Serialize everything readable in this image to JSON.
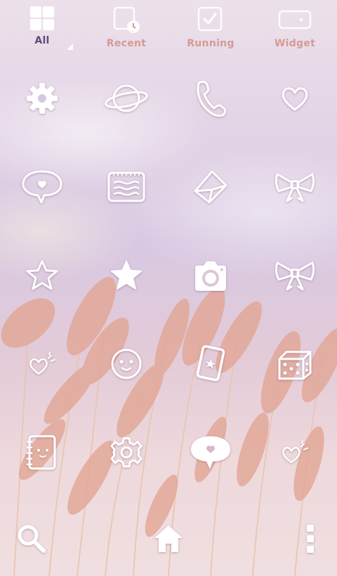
{
  "tabs": [
    {
      "label": "All",
      "icon": "grid-icon",
      "active": true
    },
    {
      "label": "Recent",
      "icon": "recent-clock-icon",
      "active": false
    },
    {
      "label": "Running",
      "icon": "checkbox-icon",
      "active": false
    },
    {
      "label": "Widget",
      "icon": "widget-icon",
      "active": false
    }
  ],
  "apps": [
    {
      "icon": "gear-icon"
    },
    {
      "icon": "planet-icon"
    },
    {
      "icon": "phone-icon"
    },
    {
      "icon": "heart-icon"
    },
    {
      "icon": "heart-speech-bubble-icon"
    },
    {
      "icon": "notepad-icon"
    },
    {
      "icon": "envelope-icon"
    },
    {
      "icon": "ribbon-bow-icon"
    },
    {
      "icon": "star-outline-icon"
    },
    {
      "icon": "star-filled-icon"
    },
    {
      "icon": "camera-icon"
    },
    {
      "icon": "ribbon-bow-icon"
    },
    {
      "icon": "small-heart-icon"
    },
    {
      "icon": "smiley-face-icon"
    },
    {
      "icon": "playing-card-icon"
    },
    {
      "icon": "dice-icon"
    },
    {
      "icon": "notebook-face-icon"
    },
    {
      "icon": "gear-outline-icon"
    },
    {
      "icon": "heart-speech-filled-icon"
    },
    {
      "icon": "small-heart-icon"
    }
  ],
  "dock": [
    {
      "icon": "search-icon"
    },
    {
      "icon": "home-icon"
    },
    {
      "icon": "more-vertical-icon"
    }
  ],
  "colors": {
    "tab_active": "#5b4d78",
    "tab_inactive": "#d59a95",
    "icon": "#ffffff",
    "grass": "#e0a08c"
  }
}
